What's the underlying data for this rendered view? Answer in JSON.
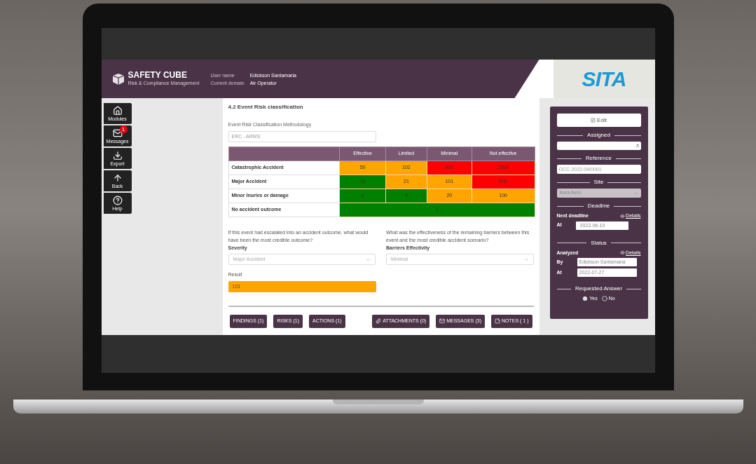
{
  "header": {
    "brand": "SAFETY CUBE",
    "tagline": "Risk & Compliance Management",
    "user_label": "User name",
    "user": "Edickson Santamaria",
    "domain_label": "Current domain",
    "domain": "Air Operator",
    "partner_logo": "SITA"
  },
  "sidebar": [
    {
      "kind": "home",
      "label": "Modules"
    },
    {
      "kind": "mail",
      "label": "Messages",
      "badge": "1"
    },
    {
      "kind": "download",
      "label": "Export"
    },
    {
      "kind": "up",
      "label": "Back"
    },
    {
      "kind": "help",
      "label": "Help"
    }
  ],
  "section_title": "4.2 Event Risk classification",
  "methodology": {
    "label": "Event Risk Classification Methodology",
    "value": "ERC - ARMS"
  },
  "matrix": {
    "columns": [
      "Effective",
      "Limited",
      "Minimal",
      "Not effective"
    ],
    "rows": [
      {
        "label": "Catastrophic Accident",
        "cells": [
          {
            "text": "50",
            "color": "#ffa500"
          },
          {
            "text": "102",
            "color": "#ffa500"
          },
          {
            "text": "502",
            "color": "#ff0000"
          },
          {
            "text": "2500",
            "color": "#ff0000"
          }
        ]
      },
      {
        "label": "Major Accident",
        "cells": [
          {
            "text": "10",
            "color": "#008000"
          },
          {
            "text": "21",
            "color": "#ffa500"
          },
          {
            "text": "101",
            "color": "#ffa500"
          },
          {
            "text": "500",
            "color": "#ff0000"
          }
        ]
      },
      {
        "label": "Minor Inuries or damage",
        "cells": [
          {
            "text": "2",
            "color": "#008000"
          },
          {
            "text": "4",
            "color": "#008000"
          },
          {
            "text": "20",
            "color": "#ffa500"
          },
          {
            "text": "100",
            "color": "#ffa500"
          }
        ]
      },
      {
        "label": "No accident outcome",
        "cells": [
          {
            "text": "1",
            "color": "#008000",
            "colspan": 4
          }
        ]
      }
    ]
  },
  "questions": [
    {
      "question": "If this event had escalated into an accident outcome, what would have been the most credible outcome?",
      "label": "Severity",
      "value": "Major Accident"
    },
    {
      "question": "What was the effectiveness of the remaining barriers between this event and the most credible accident scenario?",
      "label": "Barriers Effectivity",
      "value": "Minimal"
    }
  ],
  "result": {
    "label": "Result",
    "value": "101",
    "color": "#ffa500"
  },
  "buttons": [
    {
      "kind": "plain",
      "label": "FINDINGS (1)"
    },
    {
      "kind": "plain",
      "label": "RISKS (1)"
    },
    {
      "kind": "plain",
      "label": "ACTIONS (1)"
    },
    {
      "kind": "attach",
      "label": "ATTACHMENTS (0)"
    },
    {
      "kind": "mail",
      "label": "MESSAGES (3)"
    },
    {
      "kind": "note",
      "label": "NOTES ( 1 )"
    }
  ],
  "panel": {
    "edit": "Edit",
    "assigned": {
      "title": "Assigned"
    },
    "reference": {
      "title": "Reference",
      "value": "OCC-2022-04/0001"
    },
    "site": {
      "title": "Site",
      "value": "Aura Aero"
    },
    "deadline": {
      "title": "Deadline",
      "label": "Next deadline",
      "details": "Details",
      "at_label": "At",
      "at": "2022-06-10"
    },
    "status": {
      "title": "Status",
      "label": "Analyzed",
      "details": "Details",
      "by_label": "By",
      "by": "Edickson Santamaria",
      "at_label": "At",
      "at": "2022-07-27"
    },
    "requested": {
      "title": "Requested Answer",
      "options": [
        {
          "label": "Yes",
          "selected": true
        },
        {
          "label": "No",
          "selected": false
        }
      ]
    }
  }
}
